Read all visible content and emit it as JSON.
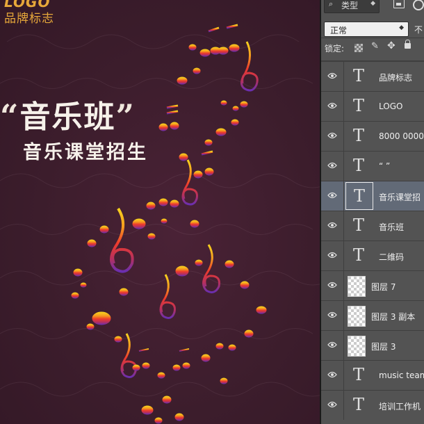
{
  "poster": {
    "logo": "LOGO",
    "brand": "品牌标志",
    "title_open_quote": "“",
    "title": "音乐班",
    "title_close_quote": "”",
    "subtitle": "音乐课堂招生",
    "colors": {
      "background": "#3c1d2c",
      "accent_logo": "#e7a83a",
      "note_top": "#f3c21f",
      "note_mid": "#ef4b2a",
      "note_bottom": "#9b2f6d"
    }
  },
  "panel": {
    "filter_label": "类型",
    "blend_mode": "正常",
    "opacity_label": "不",
    "lock_label": "锁定:",
    "layers": [
      {
        "name": "品牌标志",
        "kind": "text",
        "icon": "text-layer-icon"
      },
      {
        "name": "LOGO",
        "kind": "text",
        "icon": "text-layer-icon"
      },
      {
        "name": "8000 0000 -",
        "kind": "text",
        "icon": "text-layer-icon"
      },
      {
        "name": "“    ”",
        "kind": "text",
        "icon": "text-layer-icon"
      },
      {
        "name": "音乐课堂招",
        "kind": "text",
        "icon": "text-layer-icon",
        "selected": true
      },
      {
        "name": "音乐班",
        "kind": "text",
        "icon": "text-layer-icon"
      },
      {
        "name": "二维码",
        "kind": "text",
        "icon": "text-layer-icon"
      },
      {
        "name": "图层 7",
        "kind": "pixel",
        "icon": "transparent-thumbnail"
      },
      {
        "name": "图层 3 副本",
        "kind": "pixel",
        "icon": "transparent-thumbnail"
      },
      {
        "name": "图层 3",
        "kind": "pixel",
        "icon": "transparent-thumbnail"
      },
      {
        "name": "music team",
        "kind": "text",
        "icon": "text-layer-icon"
      },
      {
        "name": "培训工作机",
        "kind": "text",
        "icon": "text-layer-icon"
      }
    ]
  }
}
